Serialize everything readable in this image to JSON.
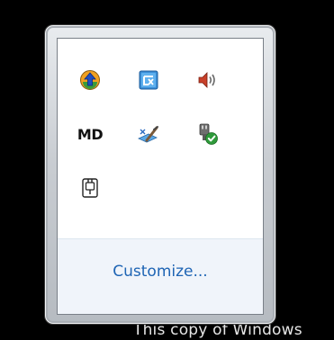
{
  "tray": {
    "icons": [
      {
        "name": "upload-arrow-icon"
      },
      {
        "name": "language-bar-icon"
      },
      {
        "name": "speaker-volume-icon"
      },
      {
        "name": "md-text-icon",
        "label": "MD"
      },
      {
        "name": "pen-tablet-icon"
      },
      {
        "name": "safely-remove-hardware-icon"
      },
      {
        "name": "power-plug-icon"
      }
    ]
  },
  "customize": {
    "label": "Customize..."
  },
  "watermark": {
    "text": "This copy of Windows"
  },
  "colors": {
    "link": "#1e64b4",
    "customize_bg": "#f0f4fa",
    "desktop": "#000000"
  }
}
